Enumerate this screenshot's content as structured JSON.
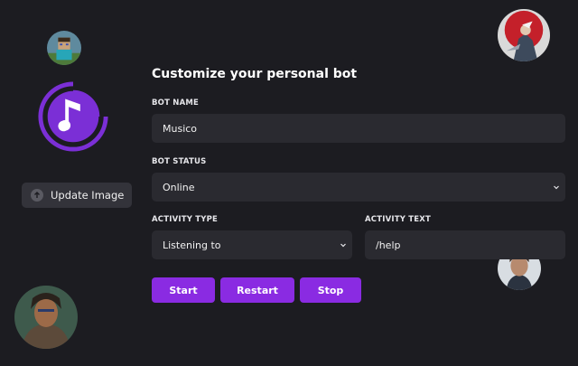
{
  "form": {
    "title": "Customize your personal bot",
    "bot_name_label": "BOT NAME",
    "bot_name_value": "Musico",
    "bot_status_label": "BOT STATUS",
    "bot_status_value": "Online",
    "activity_type_label": "ACTIVITY TYPE",
    "activity_type_value": "Listening to",
    "activity_text_label": "ACTIVITY TEXT",
    "activity_text_value": "/help"
  },
  "sidebar": {
    "logo_icon": "music-note-icon",
    "update_image_label": "Update Image",
    "update_icon": "upload-icon"
  },
  "buttons": {
    "start_label": "Start",
    "restart_label": "Restart",
    "stop_label": "Stop"
  },
  "colors": {
    "background": "#1c1c21",
    "field": "#2a2a30",
    "accent": "#8a2be2",
    "logo": "#7b2fd6"
  }
}
